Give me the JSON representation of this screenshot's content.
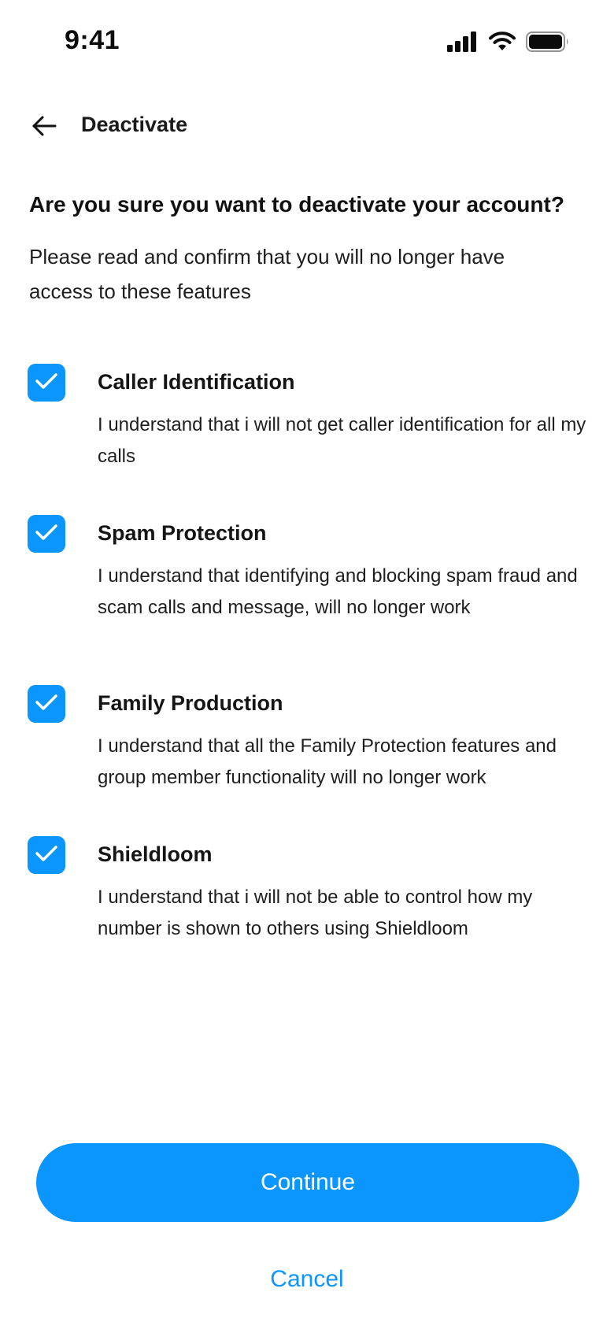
{
  "status_bar": {
    "time": "9:41"
  },
  "header": {
    "back_icon": "arrow-left-icon",
    "title": "Deactivate"
  },
  "intro": {
    "title": "Are you sure you want to deactivate your account?",
    "text": "Please read and confirm that you will no longer have access to these features"
  },
  "features": [
    {
      "title": "Caller Identification",
      "description": "I understand that i will not get caller identification for all my calls",
      "checked": true
    },
    {
      "title": "Spam Protection",
      "description": "I understand that identifying and blocking spam fraud and scam calls and message, will no longer work",
      "checked": true
    },
    {
      "title": "Family Production",
      "description": "I understand that all the Family Protection features and group member functionality will no longer work",
      "checked": true
    },
    {
      "title": "Shieldloom",
      "description": "I understand that i will not be able to control how my number is shown to others using Shieldloom",
      "checked": true
    }
  ],
  "actions": {
    "continue_label": "Continue",
    "cancel_label": "Cancel"
  },
  "colors": {
    "accent": "#0A95FF",
    "text": "#111111",
    "background": "#FFFFFF"
  }
}
